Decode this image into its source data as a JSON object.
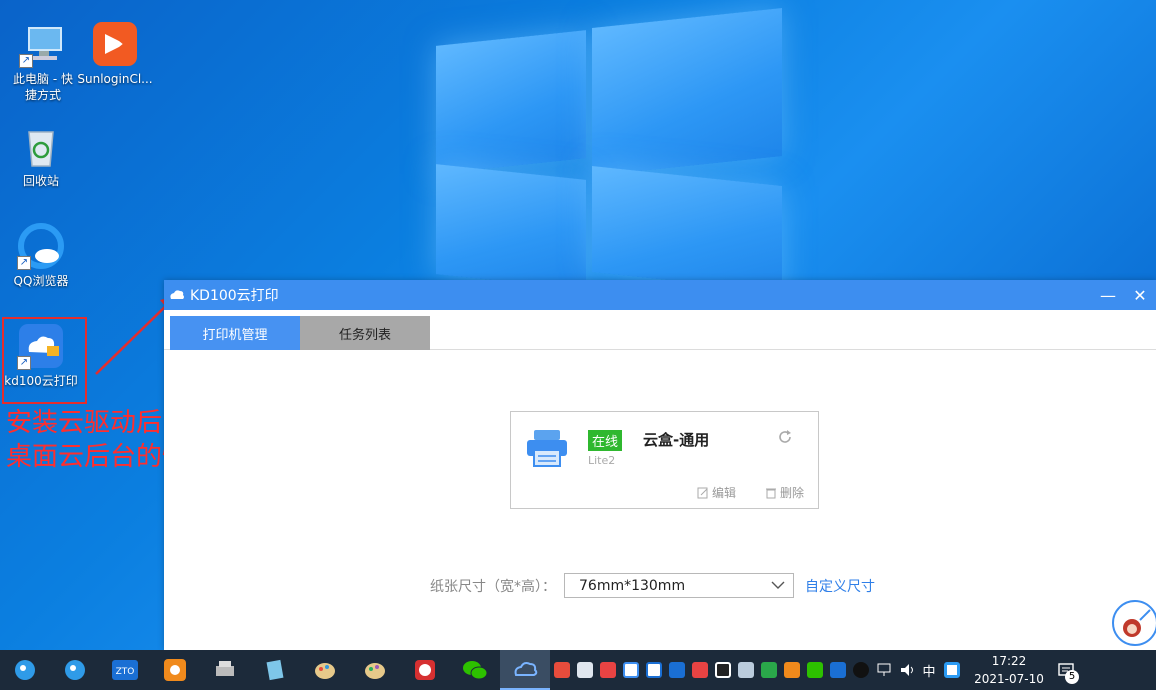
{
  "desktop": {
    "icons": [
      {
        "label": "此电脑 - 快捷方式",
        "line1": "此电脑 - 快",
        "line2": "捷方式"
      },
      {
        "label": "SunloginCl..."
      },
      {
        "label": "回收站"
      },
      {
        "label": "QQ浏览器"
      },
      {
        "label": "kd100云打印"
      }
    ],
    "annotation": {
      "line1": "安装云驱动后，",
      "line2": "桌面云后台的快捷方式"
    }
  },
  "app": {
    "title": "KD100云打印",
    "minimize": "—",
    "close": "✕",
    "tabs": [
      {
        "label": "打印机管理",
        "active": true
      },
      {
        "label": "任务列表",
        "active": false
      }
    ],
    "printer": {
      "status": "在线",
      "name": "云盒-通用",
      "model": "Lite2",
      "edit_label": "编辑",
      "delete_label": "删除"
    },
    "paper": {
      "label": "纸张尺寸（宽*高）：",
      "value": "76mm*130mm",
      "custom_label": "自定义尺寸"
    }
  },
  "taskbar": {
    "ime": "中",
    "time": "17:22",
    "date": "2021-07-10",
    "notification_count": "5"
  },
  "colors": {
    "accent": "#3d8ef0",
    "online": "#2fb82f",
    "annotation": "#ff2e2e"
  }
}
